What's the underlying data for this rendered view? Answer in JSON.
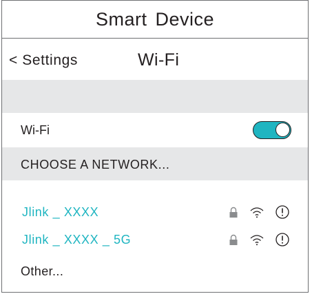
{
  "app": {
    "title": "Smart Device"
  },
  "nav": {
    "back_label": "< Settings",
    "title": "Wi-Fi"
  },
  "wifi": {
    "label": "Wi-Fi",
    "enabled": true
  },
  "section": {
    "header": "CHOOSE A NETWORK..."
  },
  "networks": [
    {
      "name": "Jlink _ XXXX",
      "secured": true,
      "icons": [
        "lock-icon",
        "wifi-signal-icon",
        "info-icon"
      ]
    },
    {
      "name": "Jlink _ XXXX _ 5G",
      "secured": true,
      "icons": [
        "lock-icon",
        "wifi-signal-icon",
        "info-icon"
      ]
    }
  ],
  "other": {
    "label": "Other..."
  },
  "colors": {
    "accent": "#1fb5c1",
    "section_bg": "#e6e7e8",
    "text": "#231f20",
    "border": "#6d6e71"
  }
}
